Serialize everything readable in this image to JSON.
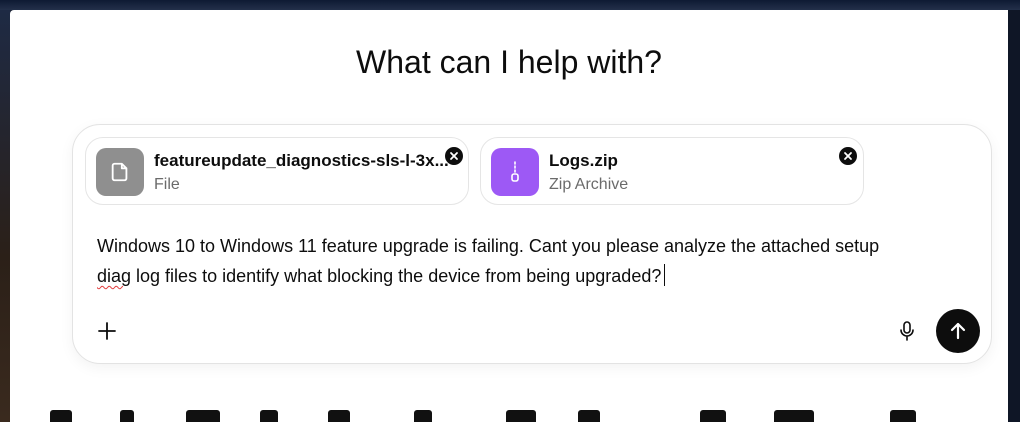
{
  "main": {
    "heading": "What can I help with?"
  },
  "composer": {
    "attachments": [
      {
        "name": "featureupdate_diagnostics-sls-l-3x...",
        "type": "File",
        "icon": "document-icon",
        "icon_color": "#8f8f8f"
      },
      {
        "name": "Logs.zip",
        "type": "Zip Archive",
        "icon": "zip-archive-icon",
        "icon_color": "#9d59f5"
      }
    ],
    "prompt_line1": "Windows 10 to Windows 11 feature upgrade is failing. Cant you please analyze the attached setup",
    "prompt_misspelled": "diag",
    "prompt_line2_rest": " log files to identify what blocking the device from being upgraded?",
    "add_icon": "plus-icon",
    "mic_icon": "microphone-icon",
    "send_icon": "arrow-up-icon"
  },
  "colors": {
    "send_button": "#0d0d0d",
    "spellcheck_underline": "#e23b3b"
  }
}
